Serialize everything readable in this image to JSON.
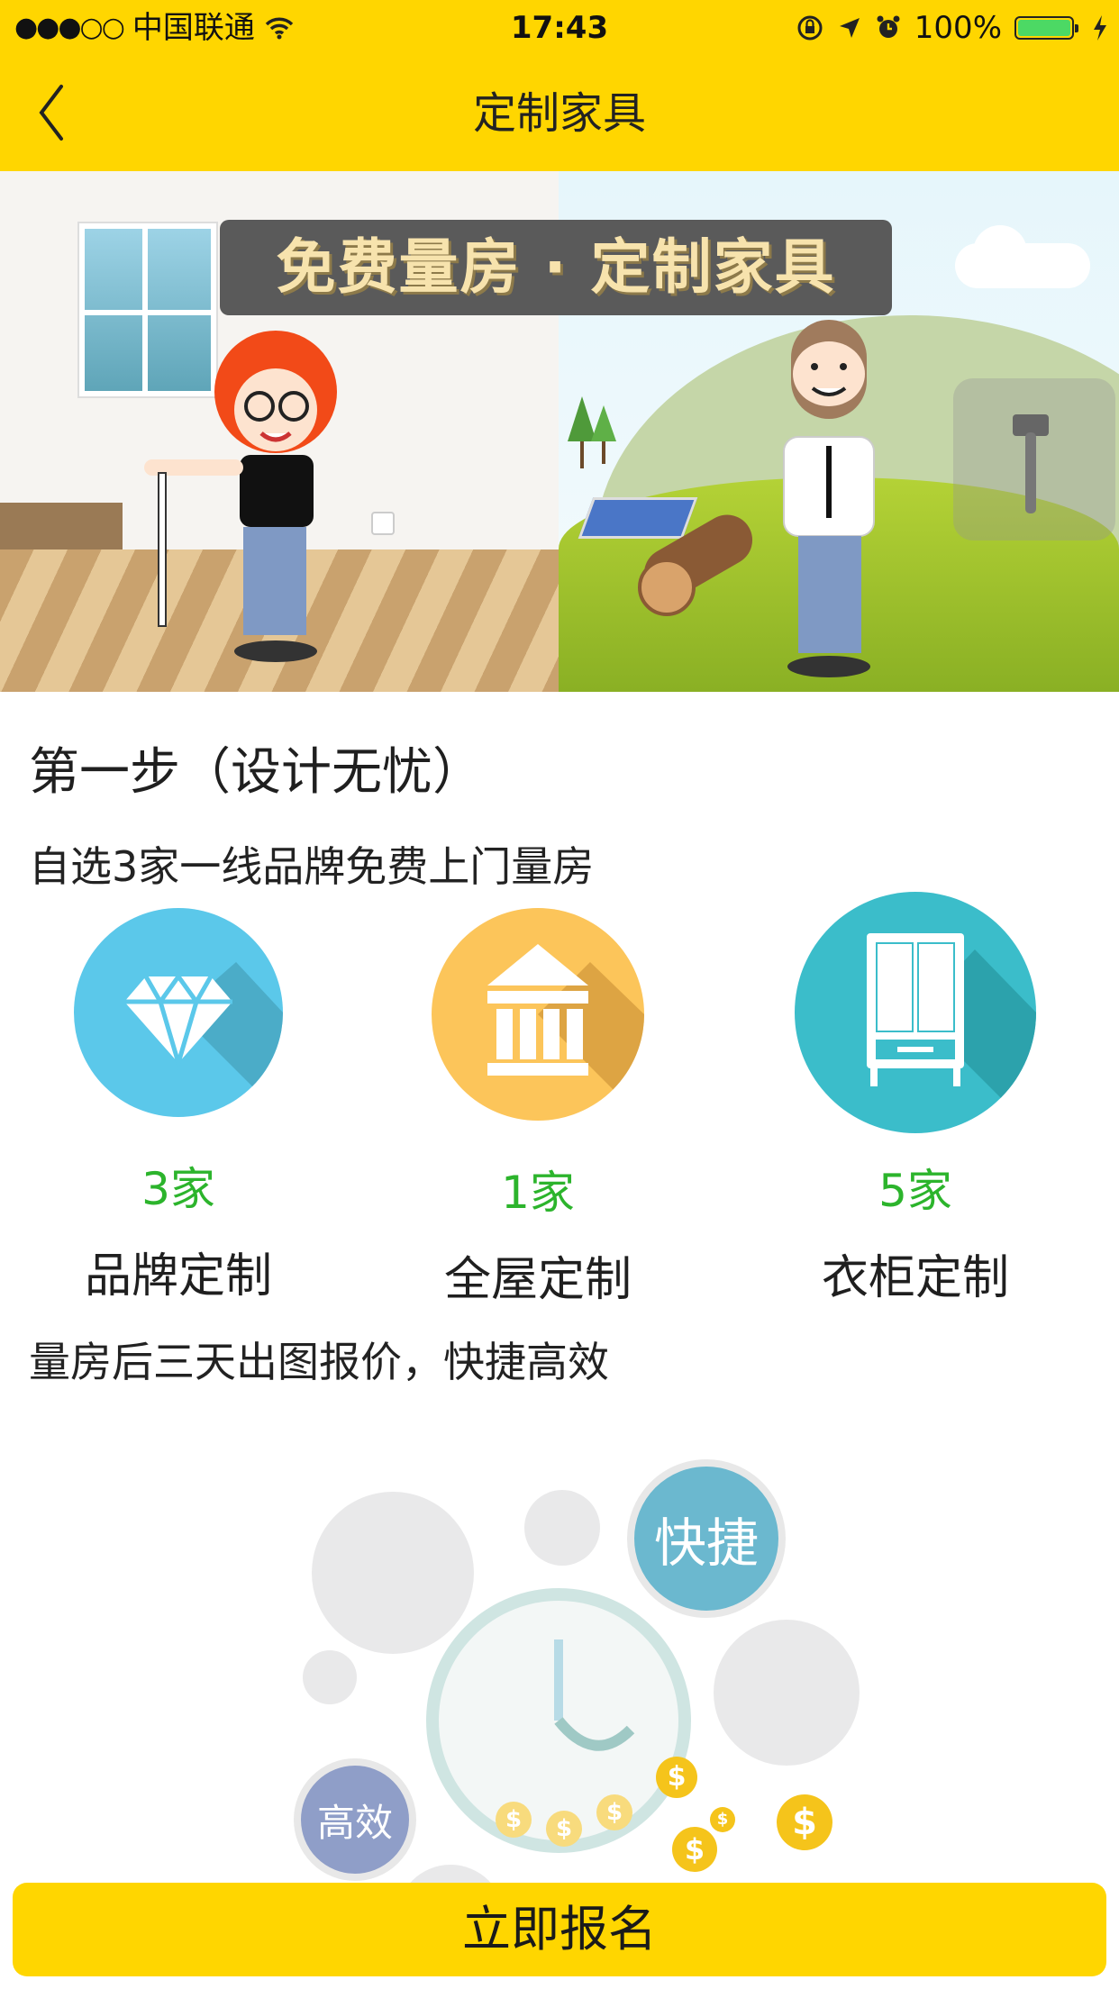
{
  "status_bar": {
    "signal_dots": "●●●○○",
    "carrier": "中国联通",
    "time": "17:43",
    "battery_percent": "100%",
    "battery_color": "#4cd964"
  },
  "nav": {
    "title": "定制家具",
    "back_icon": "chevron-left-icon",
    "background_color": "#ffd600"
  },
  "banner": {
    "headline": "免费量房 · 定制家具"
  },
  "step": {
    "title": "第一步（设计无忧）",
    "subtitle": "自选3家一线品牌免费上门量房"
  },
  "features": [
    {
      "icon": "diamond-icon",
      "count": "3家",
      "label": "品牌定制",
      "color": "#5bc8ea"
    },
    {
      "icon": "bank-building-icon",
      "count": "1家",
      "label": "全屋定制",
      "color": "#fcc55a"
    },
    {
      "icon": "wardrobe-icon",
      "count": "5家",
      "label": "衣柜定制",
      "color": "#3bbdca"
    }
  ],
  "note": "量房后三天出图报价，快捷高效",
  "illustration": {
    "fast_label": "快捷",
    "efficient_label": "高效",
    "coin_symbol": "$"
  },
  "cta": {
    "label": "立即报名",
    "color": "#ffd600"
  }
}
